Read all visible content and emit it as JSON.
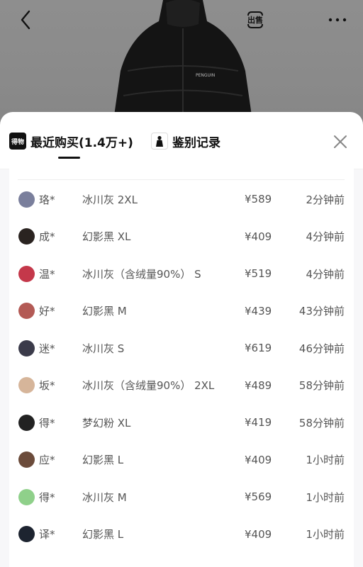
{
  "top_bar": {
    "back_icon": "chevron-left-icon",
    "sell_label": "出售",
    "more_icon": "more-dots-icon",
    "product_print": "PENGUIN"
  },
  "sheet": {
    "tabs": [
      {
        "icon_text": "得物",
        "label": "最近购买(1.4万+)"
      },
      {
        "icon": "person-icon",
        "label": "鉴别记录"
      }
    ],
    "close_icon": "close-icon"
  },
  "purchases": [
    {
      "name": "珞*",
      "spec": "冰川灰 2XL",
      "price": "¥589",
      "time": "2分钟前",
      "avatar_color": "#7a7f9c"
    },
    {
      "name": "成*",
      "spec": "幻影黑 XL",
      "price": "¥409",
      "time": "4分钟前",
      "avatar_color": "#2a2320"
    },
    {
      "name": "温*",
      "spec": "冰川灰（含绒量90%） S",
      "price": "¥519",
      "time": "4分钟前",
      "avatar_color": "#c4384a"
    },
    {
      "name": "好*",
      "spec": "幻影黑 M",
      "price": "¥439",
      "time": "43分钟前",
      "avatar_color": "#b35a55"
    },
    {
      "name": "迷*",
      "spec": "冰川灰 S",
      "price": "¥619",
      "time": "46分钟前",
      "avatar_color": "#3b3b4a"
    },
    {
      "name": "坂*",
      "spec": "冰川灰（含绒量90%） 2XL",
      "price": "¥489",
      "time": "58分钟前",
      "avatar_color": "#d6b59a"
    },
    {
      "name": "得*",
      "spec": "梦幻粉 XL",
      "price": "¥419",
      "time": "58分钟前",
      "avatar_color": "#222222"
    },
    {
      "name": "应*",
      "spec": "幻影黑 L",
      "price": "¥409",
      "time": "1小时前",
      "avatar_color": "#6b4b3a"
    },
    {
      "name": "得*",
      "spec": "冰川灰 M",
      "price": "¥569",
      "time": "1小时前",
      "avatar_color": "#8fd08a"
    },
    {
      "name": "译*",
      "spec": "幻影黑 L",
      "price": "¥409",
      "time": "1小时前",
      "avatar_color": "#1d2430"
    }
  ]
}
